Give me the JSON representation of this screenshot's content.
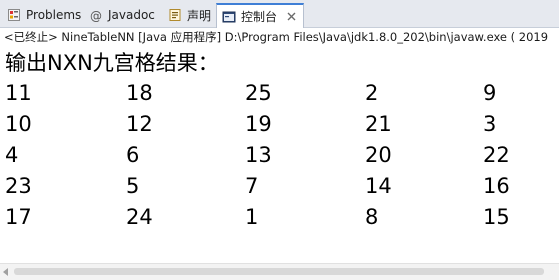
{
  "tabs": [
    {
      "label": "Problems",
      "icon": "problems-icon",
      "active": false
    },
    {
      "label": "Javadoc",
      "icon": "javadoc-icon",
      "active": false
    },
    {
      "label": "声明",
      "icon": "declaration-icon",
      "active": false
    },
    {
      "label": "控制台",
      "icon": "console-icon",
      "active": true
    }
  ],
  "tab_close_label": "✕",
  "status_line": "<已终止> NineTableNN [Java 应用程序] D:\\Program Files\\Java\\jdk1.8.0_202\\bin\\javaw.exe ( 2019",
  "console": {
    "title": "输出NXN九宫格结果：",
    "rows": [
      [
        "11",
        "18",
        "25",
        "2",
        "9"
      ],
      [
        "10",
        "12",
        "19",
        "21",
        "3"
      ],
      [
        "4",
        "6",
        "13",
        "20",
        "22"
      ],
      [
        "23",
        "5",
        "7",
        "14",
        "16"
      ],
      [
        "17",
        "24",
        "1",
        "8",
        "15"
      ]
    ]
  },
  "colors": {
    "tabbar_bg": "#e6e9ef",
    "active_tab_accent": "#3f7fd6",
    "console_text": "#000000"
  }
}
